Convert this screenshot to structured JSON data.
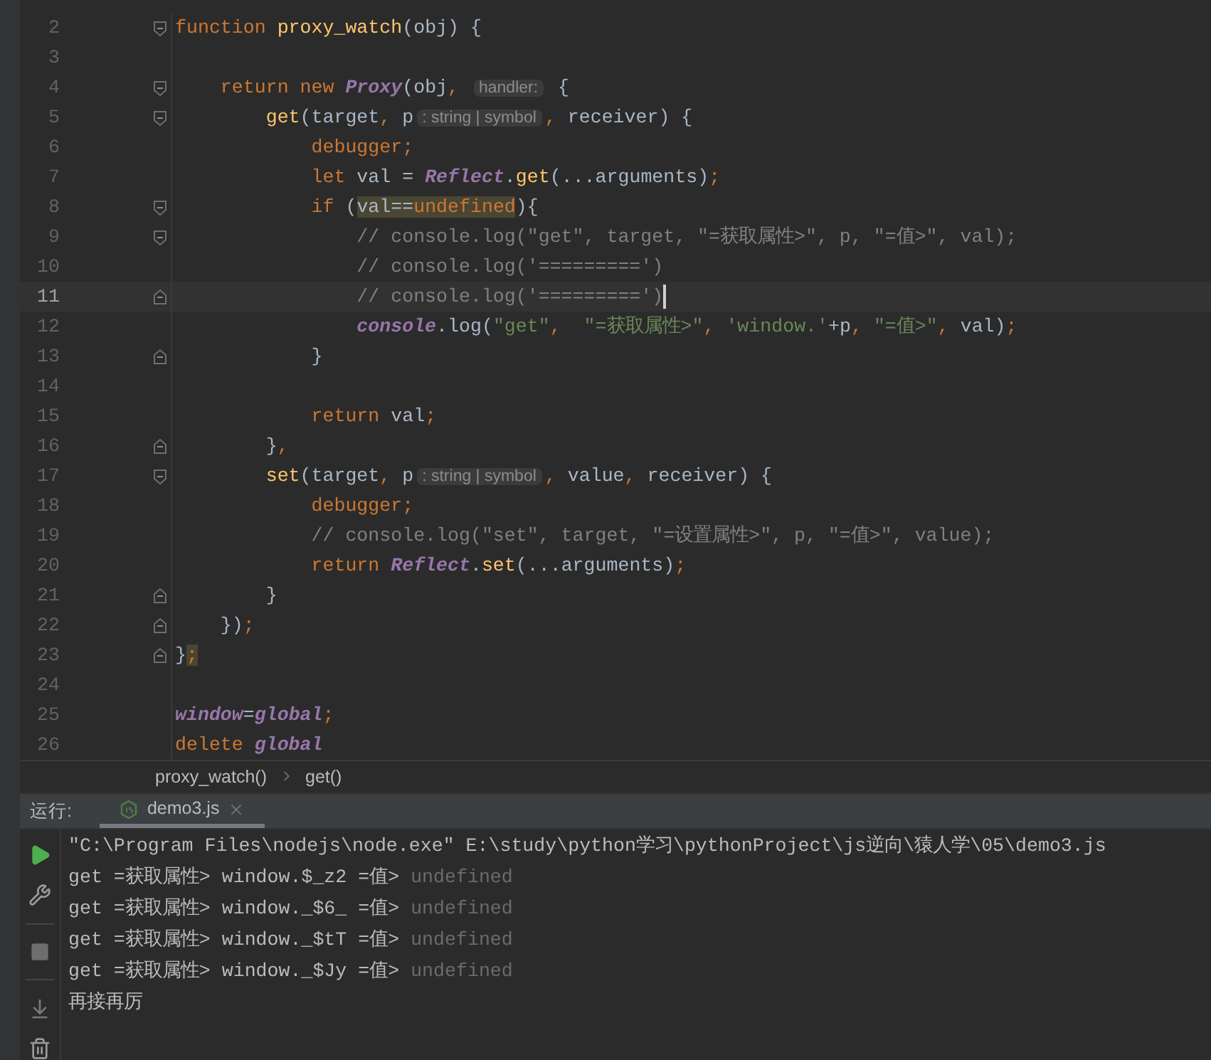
{
  "editor": {
    "lines": [
      {
        "number": "2",
        "fold": {
          "kind": "start"
        },
        "tokens": [
          {
            "text": "function ",
            "kind": "keyword"
          },
          {
            "text": "proxy_watch",
            "kind": "function"
          },
          {
            "text": "(obj) {",
            "kind": "plain"
          }
        ]
      },
      {
        "number": "3"
      },
      {
        "number": "4",
        "fold": {
          "kind": "start"
        },
        "tokens": [
          {
            "text": "    return new ",
            "kind": "keyword"
          },
          {
            "text": "Proxy",
            "kind": "class"
          },
          {
            "text": "(obj",
            "kind": "plain"
          },
          {
            "text": ", ",
            "kind": "keyword"
          },
          {
            "text": "handler:",
            "kind": "hint"
          },
          {
            "text": " {",
            "kind": "plain"
          }
        ]
      },
      {
        "number": "5",
        "fold": {
          "kind": "start"
        },
        "tokens": [
          {
            "text": "        get",
            "kind": "function"
          },
          {
            "text": "(target",
            "kind": "plain"
          },
          {
            "text": ", ",
            "kind": "keyword"
          },
          {
            "text": "p",
            "kind": "plain"
          },
          {
            "text": ": string | symbol",
            "kind": "hint"
          },
          {
            "text": ", ",
            "kind": "keyword"
          },
          {
            "text": "receiver) {",
            "kind": "plain"
          }
        ]
      },
      {
        "number": "6",
        "tokens": [
          {
            "text": "            debugger;",
            "kind": "keyword"
          }
        ]
      },
      {
        "number": "7",
        "tokens": [
          {
            "text": "            let ",
            "kind": "keyword"
          },
          {
            "text": "val = ",
            "kind": "plain"
          },
          {
            "text": "Reflect",
            "kind": "class"
          },
          {
            "text": ".",
            "kind": "plain"
          },
          {
            "text": "get",
            "kind": "function"
          },
          {
            "text": "(...arguments)",
            "kind": "plain"
          },
          {
            "text": ";",
            "kind": "keyword"
          }
        ]
      },
      {
        "number": "8",
        "fold": {
          "kind": "start"
        },
        "tokens": [
          {
            "text": "            if ",
            "kind": "keyword"
          },
          {
            "text": "(",
            "kind": "plain"
          },
          {
            "text": "val==",
            "kind": "plain",
            "highlighted": true
          },
          {
            "text": "undefined",
            "kind": "keyword",
            "highlighted": true
          },
          {
            "text": "){",
            "kind": "plain"
          }
        ]
      },
      {
        "number": "9",
        "fold": {
          "kind": "start"
        },
        "tokens": [
          {
            "text": "                // console.log(\"get\", target, \"=获取属性>\", p, \"=值>\", val);",
            "kind": "comment"
          }
        ]
      },
      {
        "number": "10",
        "tokens": [
          {
            "text": "                // console.log('=========')",
            "kind": "comment"
          }
        ]
      },
      {
        "number": "11",
        "fold": {
          "kind": "end"
        },
        "current": true,
        "tokens": [
          {
            "text": "                // console.log('=========')",
            "kind": "comment"
          }
        ]
      },
      {
        "number": "12",
        "tokens": [
          {
            "text": "                console",
            "kind": "class"
          },
          {
            "text": ".log(",
            "kind": "plain"
          },
          {
            "text": "\"get\"",
            "kind": "string"
          },
          {
            "text": ",  ",
            "kind": "keyword"
          },
          {
            "text": "\"=获取属性>\"",
            "kind": "string"
          },
          {
            "text": ", ",
            "kind": "keyword"
          },
          {
            "text": "'window.'",
            "kind": "string"
          },
          {
            "text": "+p",
            "kind": "plain"
          },
          {
            "text": ", ",
            "kind": "keyword"
          },
          {
            "text": "\"=值>\"",
            "kind": "string"
          },
          {
            "text": ", ",
            "kind": "keyword"
          },
          {
            "text": "val)",
            "kind": "plain"
          },
          {
            "text": ";",
            "kind": "keyword"
          }
        ]
      },
      {
        "number": "13",
        "fold": {
          "kind": "end"
        },
        "tokens": [
          {
            "text": "            }",
            "kind": "plain"
          }
        ]
      },
      {
        "number": "14"
      },
      {
        "number": "15",
        "tokens": [
          {
            "text": "            return ",
            "kind": "keyword"
          },
          {
            "text": "val",
            "kind": "plain"
          },
          {
            "text": ";",
            "kind": "keyword"
          }
        ]
      },
      {
        "number": "16",
        "fold": {
          "kind": "end"
        },
        "tokens": [
          {
            "text": "        }",
            "kind": "plain"
          },
          {
            "text": ",",
            "kind": "keyword"
          }
        ]
      },
      {
        "number": "17",
        "fold": {
          "kind": "start"
        },
        "tokens": [
          {
            "text": "        set",
            "kind": "function"
          },
          {
            "text": "(target",
            "kind": "plain"
          },
          {
            "text": ", ",
            "kind": "keyword"
          },
          {
            "text": "p",
            "kind": "plain"
          },
          {
            "text": ": string | symbol",
            "kind": "hint"
          },
          {
            "text": ", ",
            "kind": "keyword"
          },
          {
            "text": "value",
            "kind": "plain"
          },
          {
            "text": ", ",
            "kind": "keyword"
          },
          {
            "text": "receiver) {",
            "kind": "plain"
          }
        ]
      },
      {
        "number": "18",
        "tokens": [
          {
            "text": "            debugger;",
            "kind": "keyword"
          }
        ]
      },
      {
        "number": "19",
        "tokens": [
          {
            "text": "            // console.log(\"set\", target, \"=设置属性>\", p, \"=值>\", value);",
            "kind": "comment"
          }
        ]
      },
      {
        "number": "20",
        "tokens": [
          {
            "text": "            return ",
            "kind": "keyword"
          },
          {
            "text": "Reflect",
            "kind": "class"
          },
          {
            "text": ".",
            "kind": "plain"
          },
          {
            "text": "set",
            "kind": "function"
          },
          {
            "text": "(...arguments)",
            "kind": "plain"
          },
          {
            "text": ";",
            "kind": "keyword"
          }
        ]
      },
      {
        "number": "21",
        "fold": {
          "kind": "end"
        },
        "tokens": [
          {
            "text": "        }",
            "kind": "plain"
          }
        ]
      },
      {
        "number": "22",
        "fold": {
          "kind": "end"
        },
        "tokens": [
          {
            "text": "    })",
            "kind": "plain"
          },
          {
            "text": ";",
            "kind": "keyword"
          }
        ]
      },
      {
        "number": "23",
        "fold": {
          "kind": "end"
        },
        "tokens": [
          {
            "text": "}",
            "kind": "plain"
          },
          {
            "text": ";",
            "kind": "keyword",
            "highlighted": true
          }
        ]
      },
      {
        "number": "24"
      },
      {
        "number": "25",
        "tokens": [
          {
            "text": "window",
            "kind": "class"
          },
          {
            "text": "=",
            "kind": "plain"
          },
          {
            "text": "global",
            "kind": "class"
          },
          {
            "text": ";",
            "kind": "keyword"
          }
        ]
      },
      {
        "number": "26",
        "tokens": [
          {
            "text": "delete ",
            "kind": "keyword"
          },
          {
            "text": "global",
            "kind": "class"
          }
        ]
      }
    ]
  },
  "breadcrumbs": [
    "proxy_watch()",
    "get()"
  ],
  "run_panel": {
    "label": "运行:",
    "tabs": [
      {
        "label": "demo3.js",
        "selected": true
      }
    ],
    "tools": [
      {
        "kind": "run"
      },
      {
        "kind": "settings"
      },
      {
        "kind": "divider"
      },
      {
        "kind": "stop"
      },
      {
        "kind": "divider"
      },
      {
        "kind": "scroll"
      },
      {
        "kind": "delete"
      }
    ],
    "output": [
      [
        {
          "text": "\"C:\\Program Files\\nodejs\\node.exe\" E:\\study\\python学习\\pythonProject\\js逆向\\猿人学\\05\\demo3.js",
          "kind": "text"
        }
      ],
      [
        {
          "text": "get =获取属性> window.$_z2 =值> ",
          "kind": "text"
        },
        {
          "text": "undefined",
          "kind": "dim"
        }
      ],
      [
        {
          "text": "get =获取属性> window._$6_ =值> ",
          "kind": "text"
        },
        {
          "text": "undefined",
          "kind": "dim"
        }
      ],
      [
        {
          "text": "get =获取属性> window._$tT =值> ",
          "kind": "text"
        },
        {
          "text": "undefined",
          "kind": "dim"
        }
      ],
      [
        {
          "text": "get =获取属性> window._$Jy =值> ",
          "kind": "text"
        },
        {
          "text": "undefined",
          "kind": "dim"
        }
      ],
      [
        {
          "text": "再接再厉",
          "kind": "text"
        }
      ]
    ]
  }
}
